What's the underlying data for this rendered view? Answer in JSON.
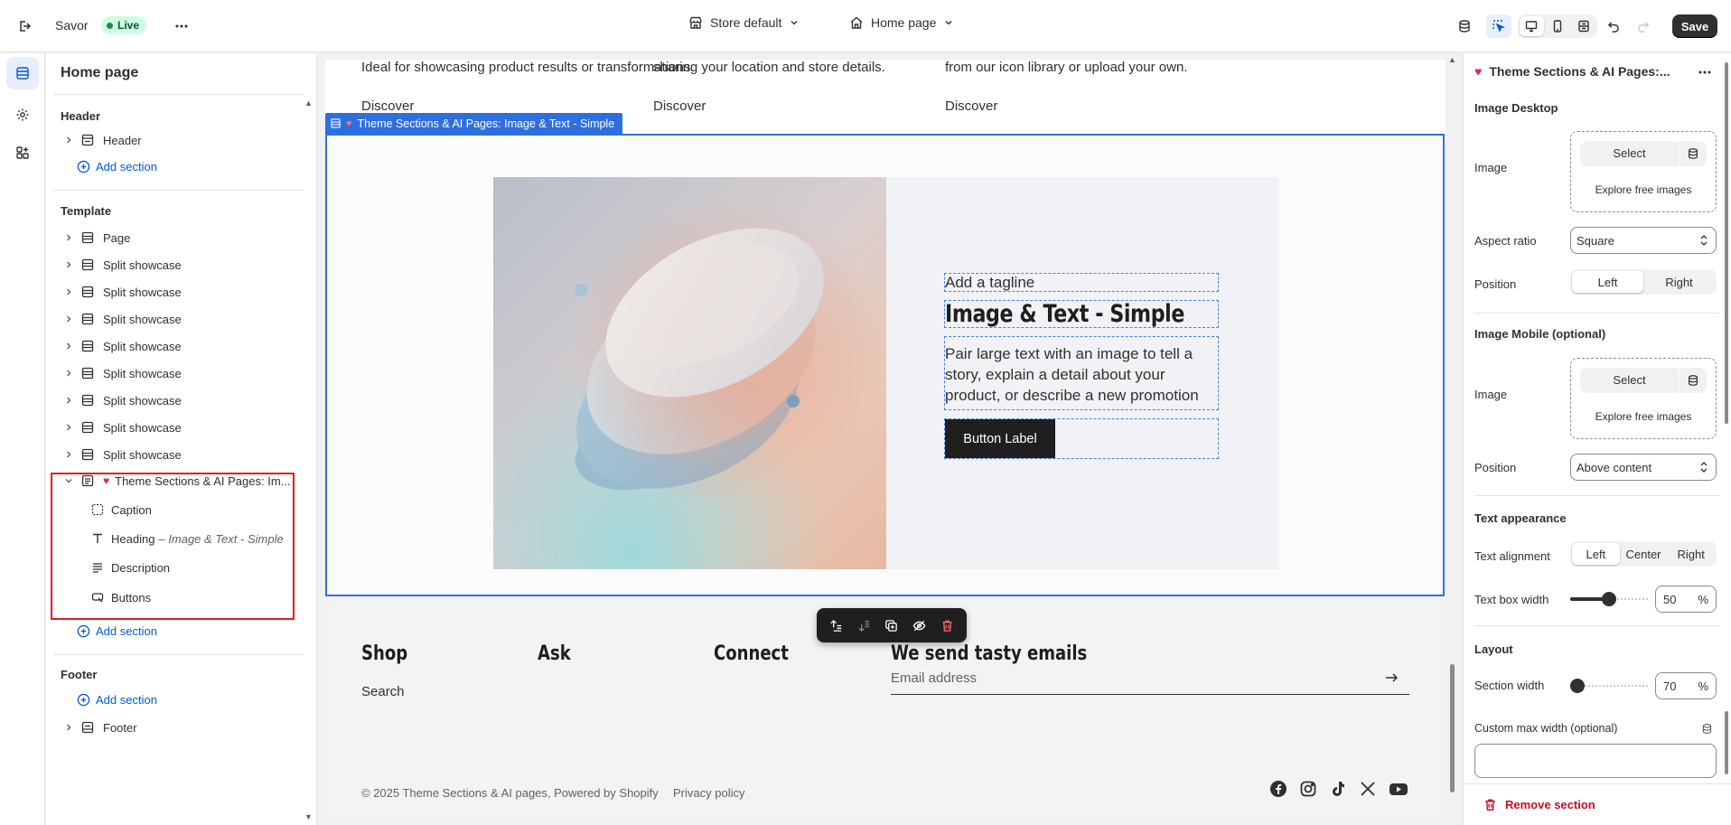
{
  "colors": {
    "accent": "#2e6fe0",
    "live_bg": "#cdfee1",
    "live_text": "#0c5132",
    "danger": "#c70a24",
    "link": "#005bd3",
    "highlight": "#e51c1c"
  },
  "topbar": {
    "theme_name": "Savor",
    "live_label": "Live",
    "store_select": "Store default",
    "page_select": "Home page",
    "save_label": "Save",
    "icons": [
      "exit-icon",
      "more-horizontal-icon",
      "store-icon",
      "home-icon",
      "database-icon",
      "inspector-icon",
      "desktop-icon",
      "mobile-icon",
      "fullwidth-icon",
      "undo-icon",
      "redo-icon"
    ]
  },
  "left_panel": {
    "title": "Home page",
    "header_group": "Header",
    "header_item": "Header",
    "add_section": "Add section",
    "template_group": "Template",
    "template_items": [
      "Page",
      "Split showcase",
      "Split showcase",
      "Split showcase",
      "Split showcase",
      "Split showcase",
      "Split showcase",
      "Split showcase",
      "Split showcase"
    ],
    "active_section": "Theme Sections & AI Pages: Im...",
    "blocks": [
      {
        "label": "Caption",
        "suffix": ""
      },
      {
        "label": "Heading",
        "suffix": "– Image & Text - Simple"
      },
      {
        "label": "Description",
        "suffix": ""
      },
      {
        "label": "Buttons",
        "suffix": ""
      }
    ],
    "footer_group": "Footer",
    "footer_item": "Footer"
  },
  "preview": {
    "prev_cols": [
      "Ideal for showcasing product results or transformations.",
      "sharing your location and store details.",
      "from our icon library or upload your own."
    ],
    "discover": "Discover",
    "section_tag": "Theme Sections & AI Pages: Image & Text - Simple",
    "tagline": "Add a tagline",
    "heading": "Image & Text - Simple",
    "description": "Pair large text with an image to tell a story, explain a detail about your product, or describe a new promotion",
    "button_label": "Button Label",
    "footer": {
      "shop": "Shop",
      "ask": "Ask",
      "connect": "Connect",
      "newsletter": "We send tasty emails",
      "search_link": "Search",
      "email_placeholder": "Email address",
      "copyright": "© 2025 Theme Sections & AI pages, Powered by Shopify",
      "privacy": "Privacy policy",
      "socials": [
        "facebook-icon",
        "instagram-icon",
        "tiktok-icon",
        "x-icon",
        "youtube-icon"
      ]
    }
  },
  "right_panel": {
    "title": "Theme Sections & AI Pages:...",
    "image_desktop": "Image Desktop",
    "image_label": "Image",
    "select": "Select",
    "explore": "Explore free images",
    "aspect_ratio_label": "Aspect ratio",
    "aspect_ratio": "Square",
    "position_label": "Position",
    "position_options": [
      "Left",
      "Right"
    ],
    "position_selected": "Left",
    "image_mobile": "Image Mobile (optional)",
    "mobile_position": "Above content",
    "text_appearance": "Text appearance",
    "text_alignment_label": "Text alignment",
    "text_alignment_options": [
      "Left",
      "Center",
      "Right"
    ],
    "text_alignment_selected": "Left",
    "text_box_width_label": "Text box width",
    "text_box_width": "50",
    "percent": "%",
    "layout": "Layout",
    "section_width_label": "Section width",
    "section_width": "70",
    "custom_max_width": "Custom max width (optional)",
    "remove_section": "Remove section"
  }
}
